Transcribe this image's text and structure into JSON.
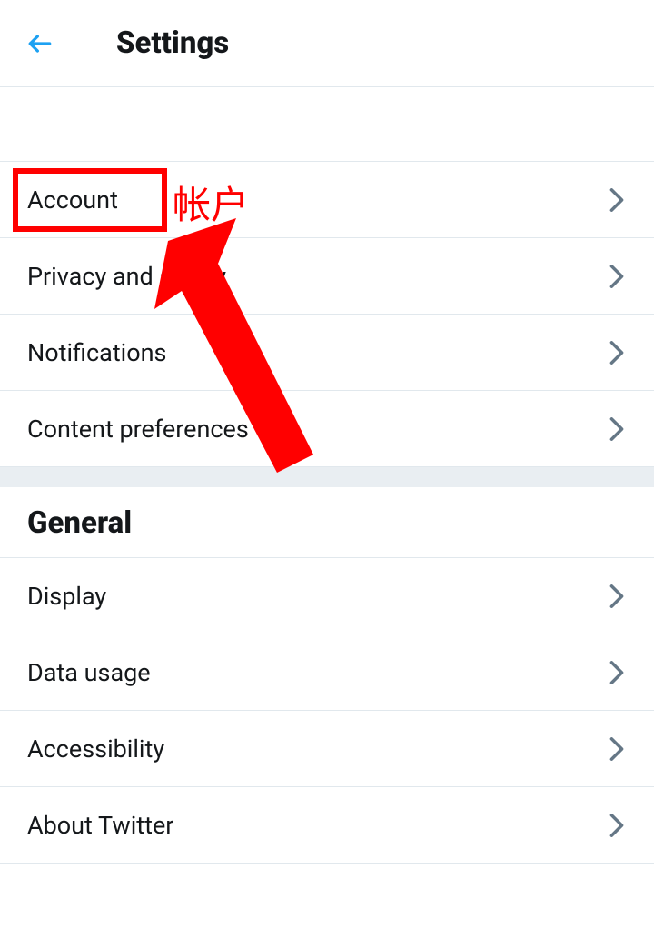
{
  "header": {
    "title": "Settings"
  },
  "sections": {
    "top_items": [
      {
        "label": "Account"
      },
      {
        "label": "Privacy and safety"
      },
      {
        "label": "Notifications"
      },
      {
        "label": "Content preferences"
      }
    ],
    "general_header": "General",
    "general_items": [
      {
        "label": "Display"
      },
      {
        "label": "Data usage"
      },
      {
        "label": "Accessibility"
      },
      {
        "label": "About Twitter"
      }
    ]
  },
  "annotation": {
    "text": "帐户"
  }
}
